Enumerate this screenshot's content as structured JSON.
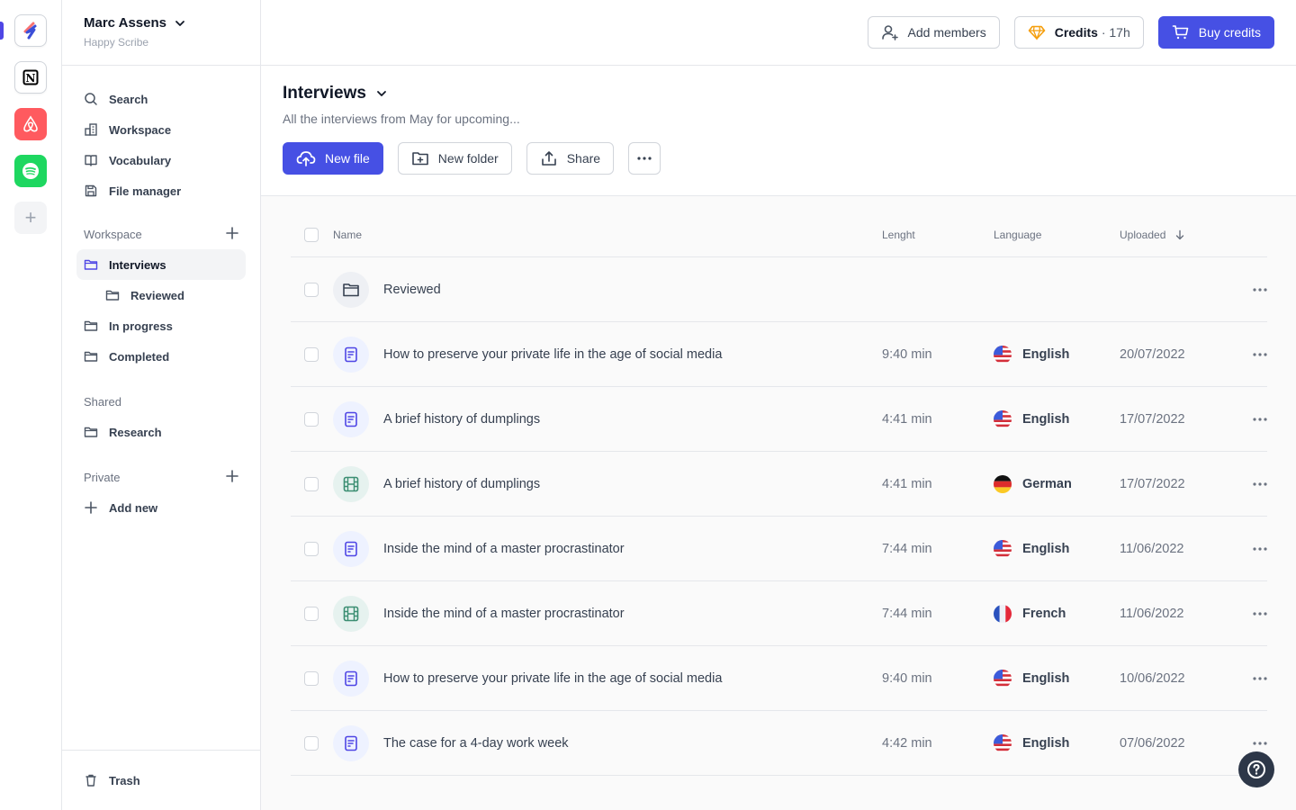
{
  "rail": {
    "apps": [
      {
        "name": "Happy Scribe",
        "icon": "happyscribe-logo-icon",
        "active": true
      },
      {
        "name": "Notion",
        "icon": "notion-logo-icon"
      },
      {
        "name": "Airbnb",
        "icon": "airbnb-logo-icon"
      },
      {
        "name": "Spotify",
        "icon": "spotify-logo-icon"
      }
    ],
    "add_label": "+"
  },
  "sidebar": {
    "user_name": "Marc Assens",
    "org_name": "Happy Scribe",
    "nav": [
      {
        "label": "Search",
        "icon": "search-icon"
      },
      {
        "label": "Workspace",
        "icon": "building-icon"
      },
      {
        "label": "Vocabulary",
        "icon": "book-icon"
      },
      {
        "label": "File manager",
        "icon": "save-icon"
      }
    ],
    "workspace_section": "Workspace",
    "workspace_items": [
      {
        "label": "Interviews",
        "active": true
      },
      {
        "label": "Reviewed",
        "sub": true
      },
      {
        "label": "In progress"
      },
      {
        "label": "Completed"
      }
    ],
    "shared_section": "Shared",
    "shared_items": [
      {
        "label": "Research"
      }
    ],
    "private_section": "Private",
    "add_new": "Add new",
    "trash": "Trash"
  },
  "topbar": {
    "add_members": "Add members",
    "credits_label": "Credits",
    "credits_value": "· 17h",
    "buy_credits": "Buy credits"
  },
  "page": {
    "title": "Interviews",
    "description": "All the interviews from May for upcoming...",
    "new_file": "New file",
    "new_folder": "New folder",
    "share": "Share"
  },
  "table": {
    "columns": {
      "name": "Name",
      "length": "Lenght",
      "language": "Language",
      "uploaded": "Uploaded"
    },
    "sort": {
      "column": "uploaded",
      "direction": "desc"
    },
    "rows": [
      {
        "type": "folder",
        "name": "Reviewed",
        "length": "",
        "language": "",
        "flag": "",
        "uploaded": ""
      },
      {
        "type": "doc",
        "name": "How to preserve your private life in the age of social media",
        "length": "9:40 min",
        "language": "English",
        "flag": "us",
        "uploaded": "20/07/2022"
      },
      {
        "type": "doc",
        "name": "A brief history of dumplings",
        "length": "4:41 min",
        "language": "English",
        "flag": "us",
        "uploaded": "17/07/2022"
      },
      {
        "type": "video",
        "name": "A brief history of dumplings",
        "length": "4:41 min",
        "language": "German",
        "flag": "de",
        "uploaded": "17/07/2022"
      },
      {
        "type": "doc",
        "name": "Inside the mind of a master procrastinator",
        "length": "7:44 min",
        "language": "English",
        "flag": "us",
        "uploaded": "11/06/2022"
      },
      {
        "type": "video",
        "name": "Inside the mind of a master procrastinator",
        "length": "7:44 min",
        "language": "French",
        "flag": "fr",
        "uploaded": "11/06/2022"
      },
      {
        "type": "doc",
        "name": "How to preserve your private life in the age of social media",
        "length": "9:40 min",
        "language": "English",
        "flag": "us",
        "uploaded": "10/06/2022"
      },
      {
        "type": "doc",
        "name": "The case for a 4-day work week",
        "length": "4:42 min",
        "language": "English",
        "flag": "us",
        "uploaded": "07/06/2022"
      }
    ]
  },
  "colors": {
    "accent": "#4650e4",
    "airbnb": "#ff5a5f",
    "spotify": "#1ed760",
    "help_bg": "#2d3748"
  }
}
